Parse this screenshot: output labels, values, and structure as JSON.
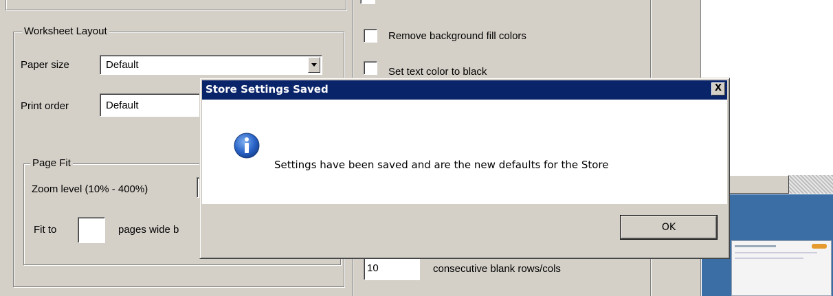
{
  "worksheet_layout": {
    "legend": "Worksheet Layout",
    "paper_size_label": "Paper size",
    "paper_size_value": "Default",
    "print_order_label": "Print order",
    "print_order_value": "Default"
  },
  "page_fit": {
    "legend": "Page Fit",
    "zoom_label": "Zoom level (10% - 400%)",
    "fit_to_label": "Fit to",
    "pages_wide_label": "pages wide b"
  },
  "right_options": {
    "remove_bg_label": "Remove background fill colors",
    "set_text_black_label": "Set text color to black",
    "blank_rows_value": "10",
    "blank_rows_label": "consecutive blank rows/cols"
  },
  "dialog": {
    "title": "Store Settings Saved",
    "close_glyph": "X",
    "message": "Settings have been saved and are the new defaults for the Store",
    "ok_label": "OK",
    "icon": "information-icon"
  }
}
